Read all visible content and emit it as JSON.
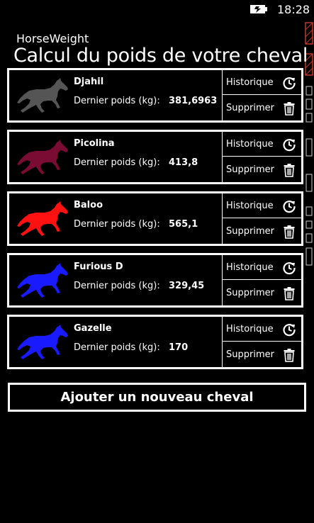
{
  "status_bar": {
    "time": "18:28",
    "battery_icon": "battery-charging-icon"
  },
  "app": {
    "name": "HorseWeight",
    "title": "Calcul du poids de votre cheval"
  },
  "horses": [
    {
      "name": "Djahil",
      "weight_label": "Dernier poids (kg):",
      "weight": "381,6963",
      "color": "#555555"
    },
    {
      "name": "Picolina",
      "weight_label": "Dernier poids (kg):",
      "weight": "413,8",
      "color": "#7a0b33"
    },
    {
      "name": "Baloo",
      "weight_label": "Dernier poids (kg):",
      "weight": "565,1",
      "color": "#ff1111"
    },
    {
      "name": "Furious D",
      "weight_label": "Dernier poids (kg):",
      "weight": "329,45",
      "color": "#1a1aff"
    },
    {
      "name": "Gazelle",
      "weight_label": "Dernier poids (kg):",
      "weight": "170",
      "color": "#1a1aff"
    }
  ],
  "actions": {
    "history_label": "Historique",
    "history_icon": "history-icon",
    "delete_label": "Supprimer",
    "delete_icon": "trash-icon"
  },
  "add_button_label": "Ajouter un nouveau cheval"
}
